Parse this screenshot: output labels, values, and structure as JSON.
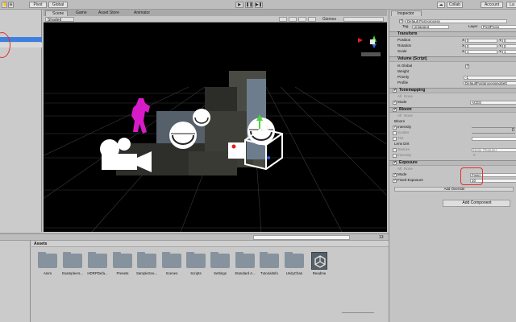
{
  "toolbar": {
    "pivot_label": "Pivot",
    "global_label": "Global",
    "collab_label": "Collab",
    "account_label": "Account",
    "layers_label": "La"
  },
  "tabs": [
    {
      "label": "Scene"
    },
    {
      "label": "Game"
    },
    {
      "label": "Asset Store"
    },
    {
      "label": "Animator"
    }
  ],
  "scene_toolbar": {
    "shading_mode": "Shaded",
    "gizmos_label": "Gizmos"
  },
  "inspector": {
    "tab_label": "Inspector",
    "object_name": "Default Post-process",
    "tag_label": "Tag",
    "tag_value": "Untagged",
    "layer_label": "Layer",
    "layer_value": "PostProce",
    "transform_label": "Transform",
    "position_label": "Position",
    "rotation_label": "Rotation",
    "scale_label": "Scale",
    "axis_x": "X",
    "axis_y": "Y",
    "position_x": "0",
    "rotation_x": "0",
    "scale_x": "1",
    "position_y": "0",
    "rotation_y": "0",
    "scale_y": "1",
    "volume_label": "Volume (Script)",
    "is_global_label": "Is Global",
    "weight_label": "Weight",
    "priority_label": "Priority",
    "priority_value": "-1",
    "profile_label": "Profile",
    "profile_value": "DefaultPostprocessingSett",
    "tonemapping_label": "Tonemapping",
    "all_label": "All",
    "none_label": "None",
    "mode_label": "Mode",
    "tonemap_mode_value": "ACES",
    "bloom_label": "Bloom",
    "bloom_sub_label": "Bloom",
    "intensity_label": "Intensity",
    "scatter_label": "Scatter",
    "tint_label": "Tint",
    "lens_dirt_label": "Lens Dirt",
    "texture_label": "Texture",
    "texture_value": "None (Texture)",
    "dirt_intensity_label": "Intensity",
    "dirt_intensity_value": "0",
    "exposure_label": "Exposure",
    "exposure_mode_value": "Fixed",
    "fixed_exposure_label": "Fixed Exposure",
    "fixed_exposure_value": "10",
    "add_override_label": "Add Override",
    "add_component_label": "Add Component"
  },
  "project": {
    "assets_header": "Assets",
    "assets": [
      {
        "name": "Anim"
      },
      {
        "name": "ExampleAs..."
      },
      {
        "name": "HDRPDefa..."
      },
      {
        "name": "Presets"
      },
      {
        "name": "SampleSce..."
      },
      {
        "name": "Scenes"
      },
      {
        "name": "Scripts"
      },
      {
        "name": "Settings"
      },
      {
        "name": "Standard A..."
      },
      {
        "name": "TutorialInfo"
      },
      {
        "name": "UnityChan"
      },
      {
        "name": "Readme"
      }
    ],
    "count_label": "13"
  },
  "colors": {
    "selection": "#3d80df",
    "annotation": "#e0302a",
    "figure": "#d81bc8",
    "viewport": "#000000",
    "folder": "#86939e"
  }
}
